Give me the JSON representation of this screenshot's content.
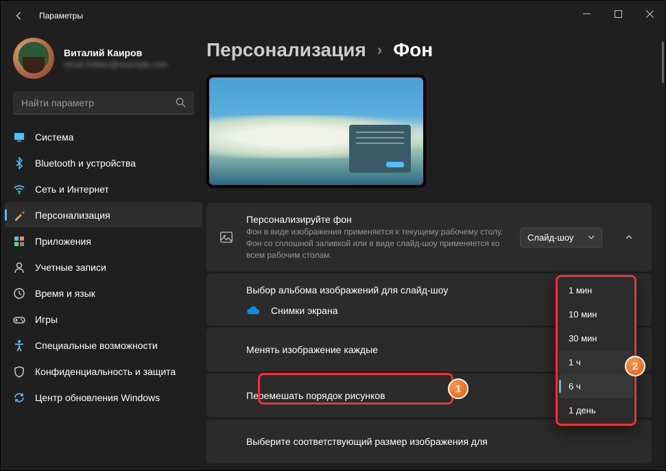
{
  "app_title": "Параметры",
  "profile": {
    "name": "Виталий Каиров",
    "email": "email.hidden@example.com"
  },
  "search": {
    "placeholder": "Найти параметр"
  },
  "nav": [
    {
      "label": "Система",
      "icon": "system"
    },
    {
      "label": "Bluetooth и устройства",
      "icon": "bluetooth"
    },
    {
      "label": "Сеть и Интернет",
      "icon": "wifi"
    },
    {
      "label": "Персонализация",
      "icon": "brush",
      "active": true
    },
    {
      "label": "Приложения",
      "icon": "apps"
    },
    {
      "label": "Учетные записи",
      "icon": "account"
    },
    {
      "label": "Время и язык",
      "icon": "time"
    },
    {
      "label": "Игры",
      "icon": "games"
    },
    {
      "label": "Специальные возможности",
      "icon": "accessibility"
    },
    {
      "label": "Конфиденциальность и защита",
      "icon": "privacy"
    },
    {
      "label": "Центр обновления Windows",
      "icon": "update"
    }
  ],
  "breadcrumb": {
    "parent": "Персонализация",
    "current": "Фон"
  },
  "personalize": {
    "title": "Персонализируйте фон",
    "desc": "Фон в виде изображения применяется к текущему рабочему столу. Фон со сплошной заливкой или в виде слайд-шоу применяется ко всем рабочим столам.",
    "value": "Слайд-шоу"
  },
  "album": {
    "title": "Выбор альбома изображений для слайд-шоу",
    "folder": "Снимки экрана"
  },
  "change_every": {
    "title": "Менять изображение каждые"
  },
  "shuffle": {
    "title": "Перемешать порядок рисунков"
  },
  "fit": {
    "title": "Выберите соответствующий размер изображения для"
  },
  "interval_options": [
    "1 мин",
    "10 мин",
    "30 мин",
    "1 ч",
    "6 ч",
    "1 день"
  ],
  "interval_selected": "6 ч",
  "badges": {
    "one": "1",
    "two": "2"
  }
}
